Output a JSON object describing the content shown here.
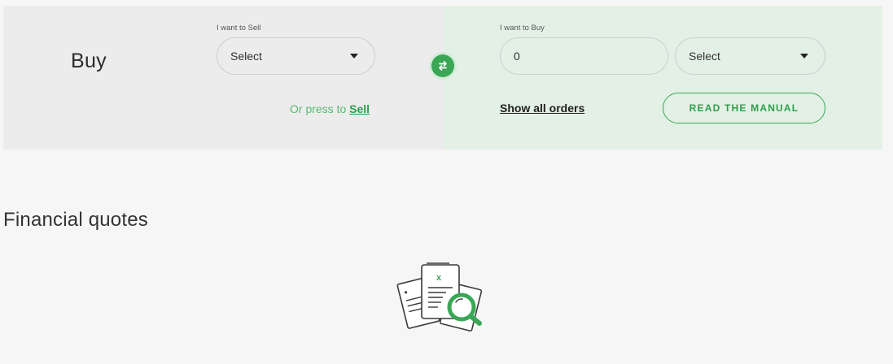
{
  "trade": {
    "title": "Buy",
    "sell_field": {
      "label": "I want to Sell",
      "selected": "Select"
    },
    "buy_field": {
      "label": "I want to Buy",
      "amount_value": "0",
      "selected": "Select"
    },
    "press_prefix": "Or press to",
    "press_link": "Sell",
    "show_orders": "Show all orders",
    "manual_button": "READ THE MANUAL",
    "swap_icon": "swap-arrows-icon"
  },
  "quotes": {
    "title": "Financial quotes",
    "empty_icon": "document-search-icon"
  },
  "colors": {
    "accent": "#3aa756",
    "sell_panel_bg": "#ececec",
    "buy_panel_bg": "#e3f0e6",
    "page_bg": "#f6f6f6"
  }
}
